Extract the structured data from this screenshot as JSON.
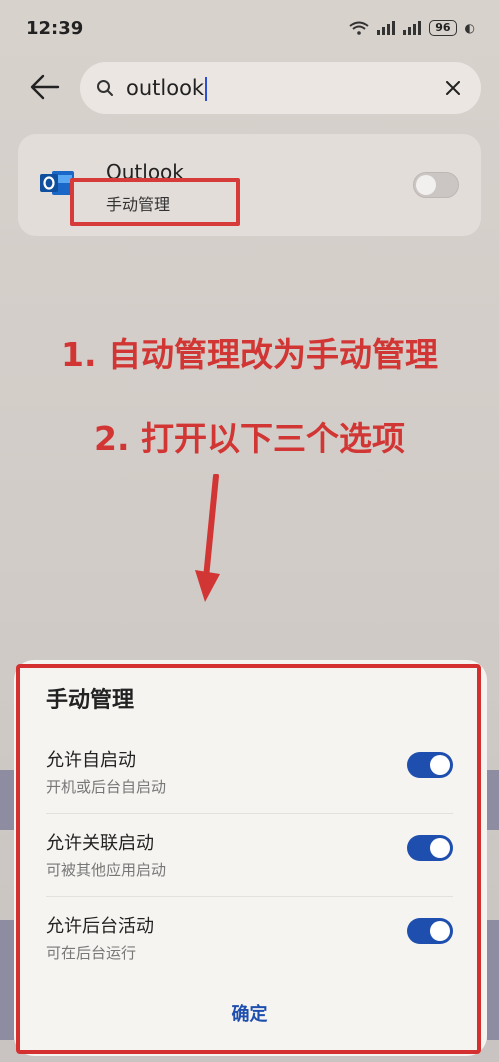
{
  "status_bar": {
    "time": "12:39",
    "battery": "96"
  },
  "search": {
    "query": "outlook"
  },
  "app_result": {
    "name": "Outlook",
    "mode": "手动管理",
    "toggle_on": false
  },
  "annotations": {
    "step1": "1. 自动管理改为手动管理",
    "step2": "2. 打开以下三个选项"
  },
  "sheet": {
    "title": "手动管理",
    "options": [
      {
        "title": "允许自启动",
        "desc": "开机或后台自启动",
        "enabled": true
      },
      {
        "title": "允许关联启动",
        "desc": "可被其他应用启动",
        "enabled": true
      },
      {
        "title": "允许后台活动",
        "desc": "可在后台运行",
        "enabled": true
      }
    ],
    "confirm": "确定"
  },
  "colors": {
    "accent": "#1e4fae",
    "annotation_red": "#d23634"
  }
}
